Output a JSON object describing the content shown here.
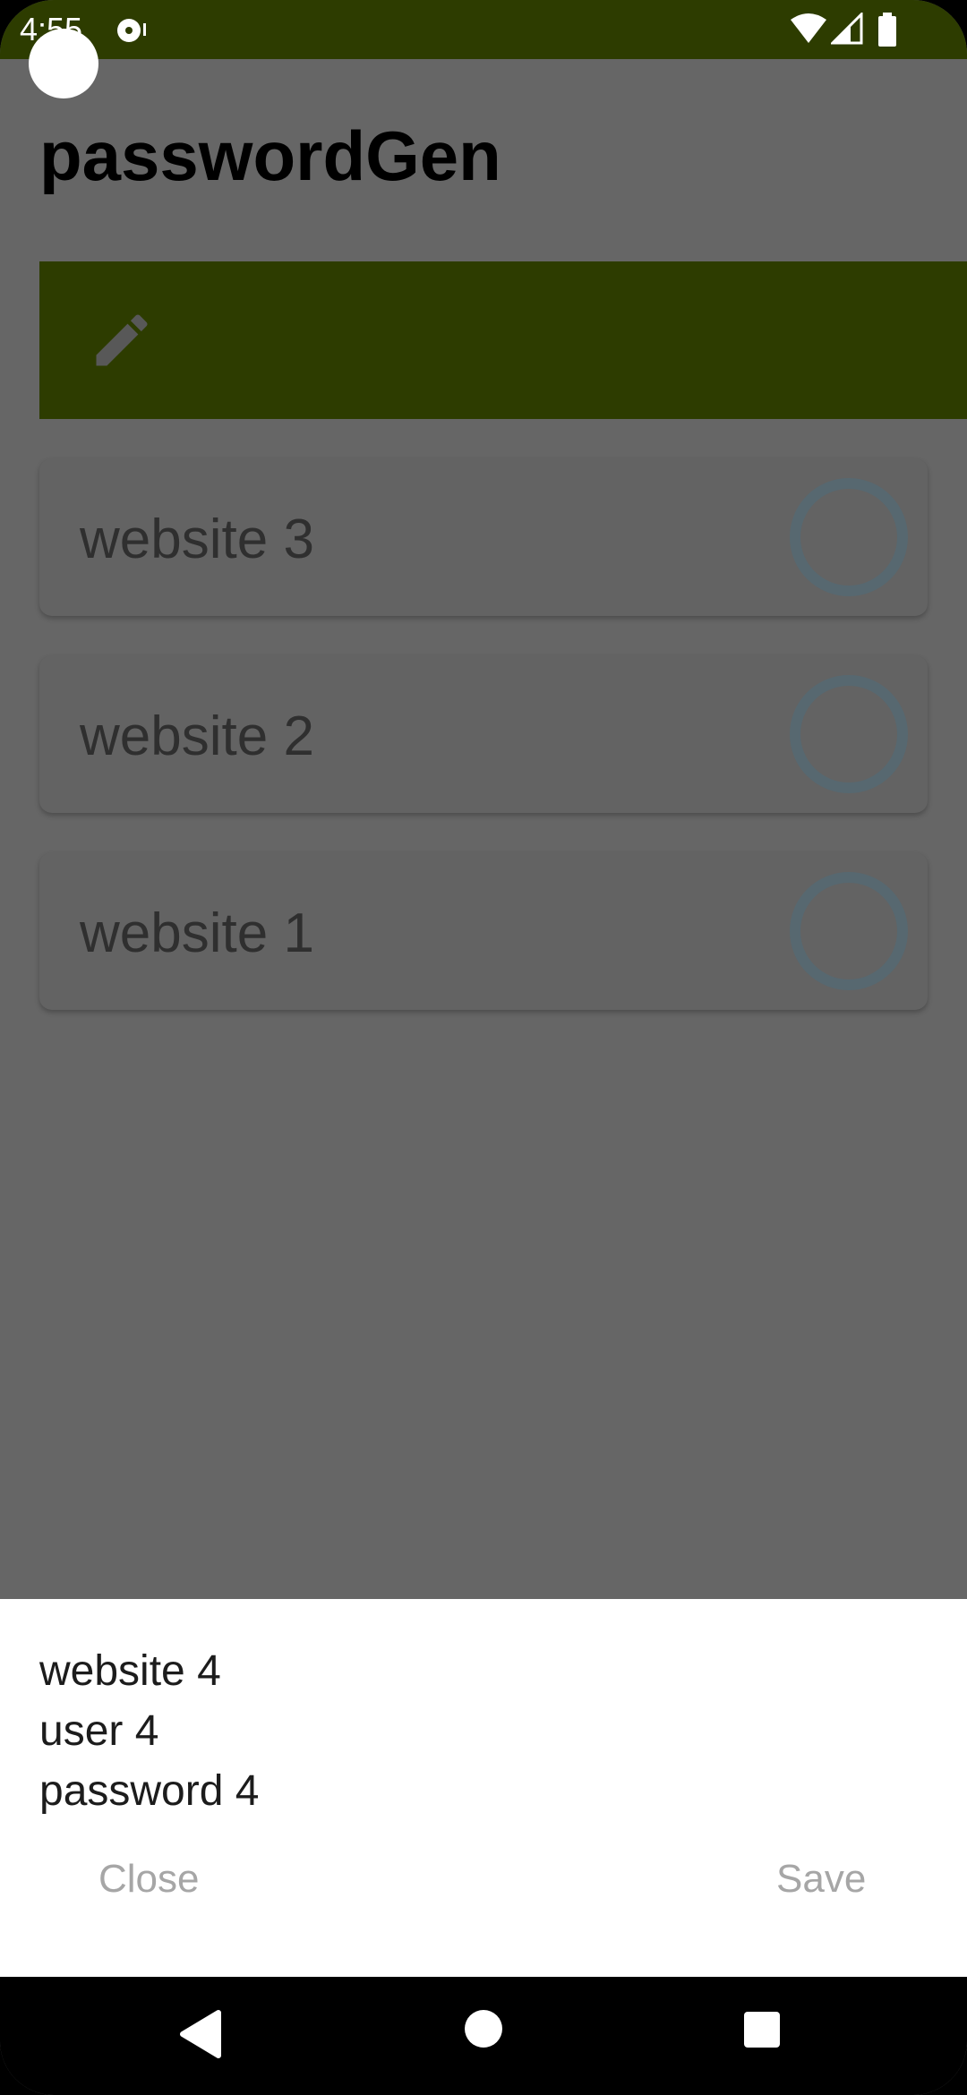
{
  "status_bar": {
    "time": "4:55",
    "icons": [
      "media-icon",
      "wifi-icon",
      "signal-icon",
      "battery-icon"
    ]
  },
  "app": {
    "title": "passwordGen",
    "edit_icon": "pencil-icon",
    "accent_color": "#2d3c00"
  },
  "entries": [
    {
      "label": "website 3",
      "selected": false
    },
    {
      "label": "website 2",
      "selected": false
    },
    {
      "label": "website 1",
      "selected": false
    }
  ],
  "dialog": {
    "website": "website 4",
    "user": "user 4",
    "password": "password 4",
    "close_label": "Close",
    "save_label": "Save"
  },
  "nav": {
    "back": "back-icon",
    "home": "home-icon",
    "recents": "recents-icon"
  }
}
